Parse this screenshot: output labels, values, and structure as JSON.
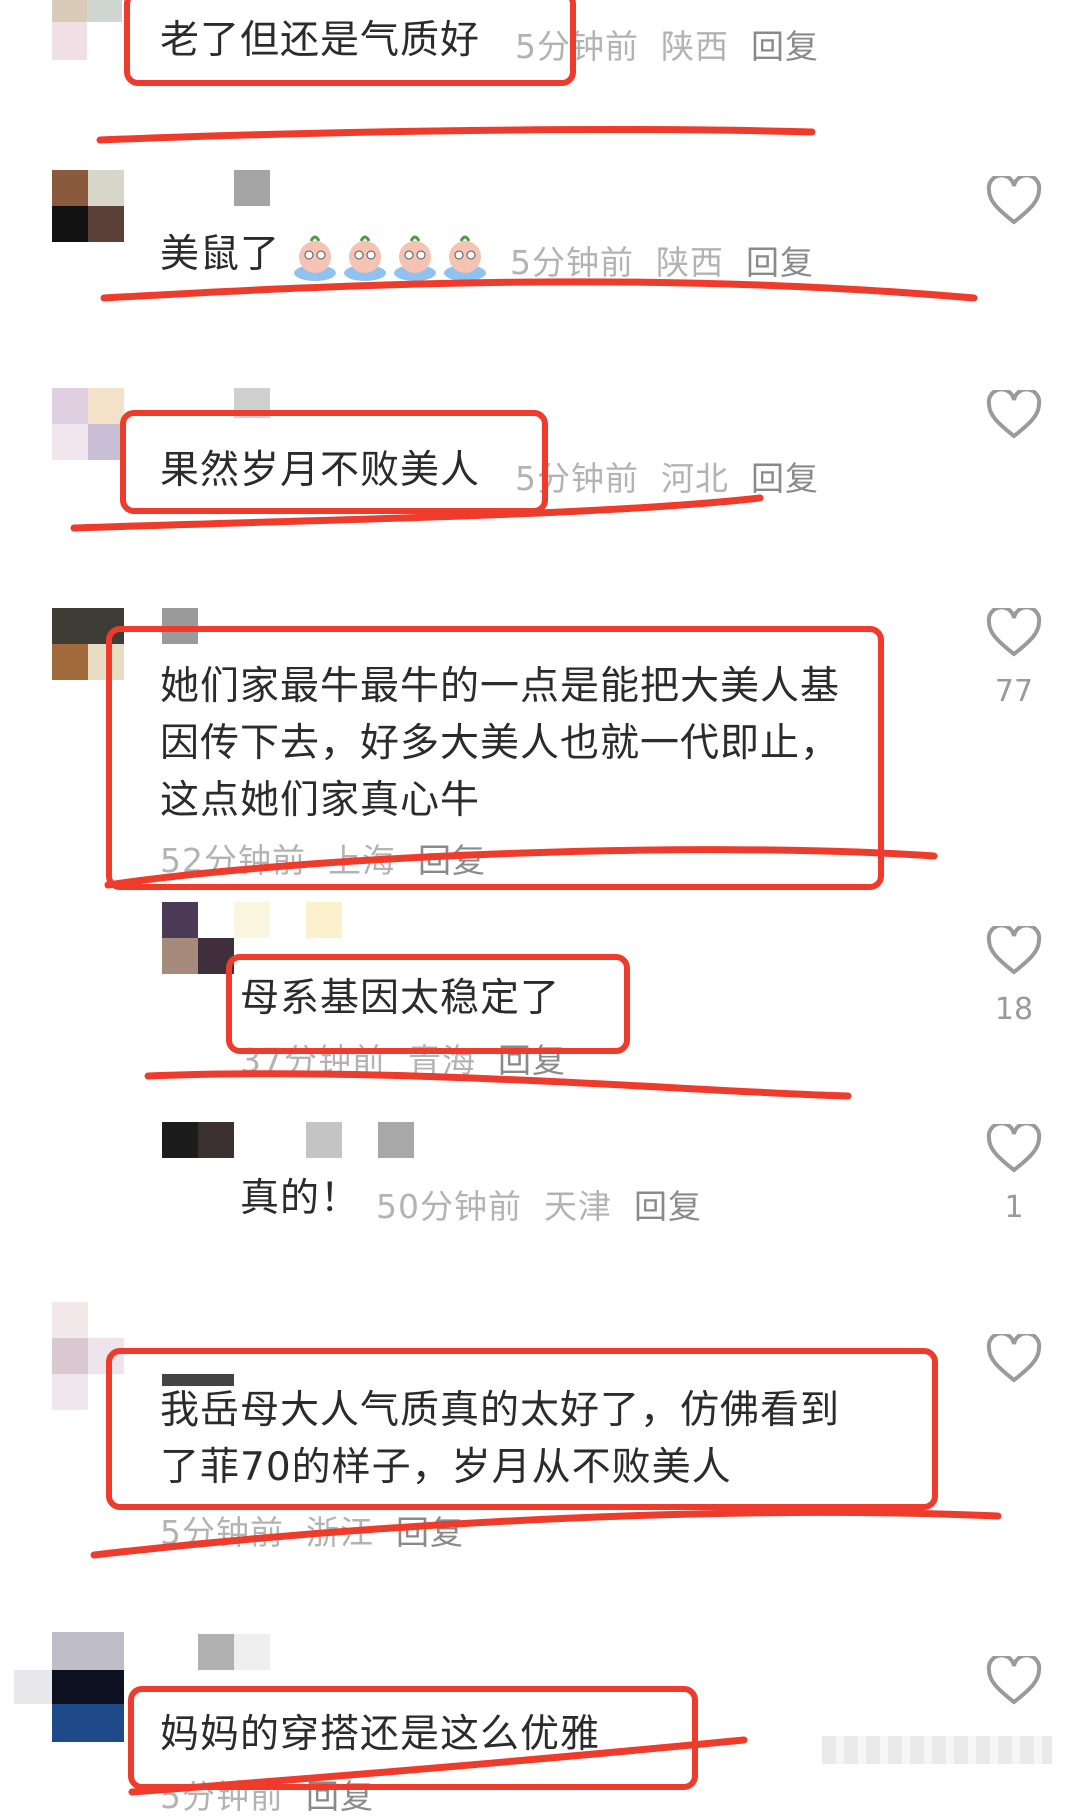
{
  "colors": {
    "accent_red": "#ee3b2c",
    "text": "#2b2b2b",
    "meta": "#b3b3b3",
    "heart": "#9a9a9a"
  },
  "comments": [
    {
      "text": "老了但还是气质好",
      "time": "5分钟前",
      "location": "陕西",
      "reply": "回复"
    },
    {
      "text": "美鼠了",
      "emoji": "peach-face-emoji x4",
      "time": "5分钟前",
      "location": "陕西",
      "reply": "回复"
    },
    {
      "text": "果然岁月不败美人",
      "time": "5分钟前",
      "location": "河北",
      "reply": "回复",
      "likes": ""
    },
    {
      "lines": [
        "她们家最牛最牛的一点是能把大美人基",
        "因传下去，好多大美人也就一代即止，",
        "这点她们家真心牛"
      ],
      "time": "52分钟前",
      "location": "上海",
      "reply": "回复",
      "likes": "77"
    },
    {
      "text": "母系基因太稳定了",
      "time": "37分钟前",
      "location": "青海",
      "reply": "回复",
      "likes": "18"
    },
    {
      "text": "真的！",
      "time": "50分钟前",
      "location": "天津",
      "reply": "回复",
      "likes": "1"
    },
    {
      "lines": [
        "我岳母大人气质真的太好了，仿佛看到",
        "了菲70的样子，岁月从不败美人"
      ],
      "time": "5分钟前",
      "location": "浙江",
      "reply": "回复"
    },
    {
      "text": "妈妈的穿搭还是这么优雅",
      "time": "5分钟前",
      "location": "",
      "reply": "回复"
    }
  ]
}
